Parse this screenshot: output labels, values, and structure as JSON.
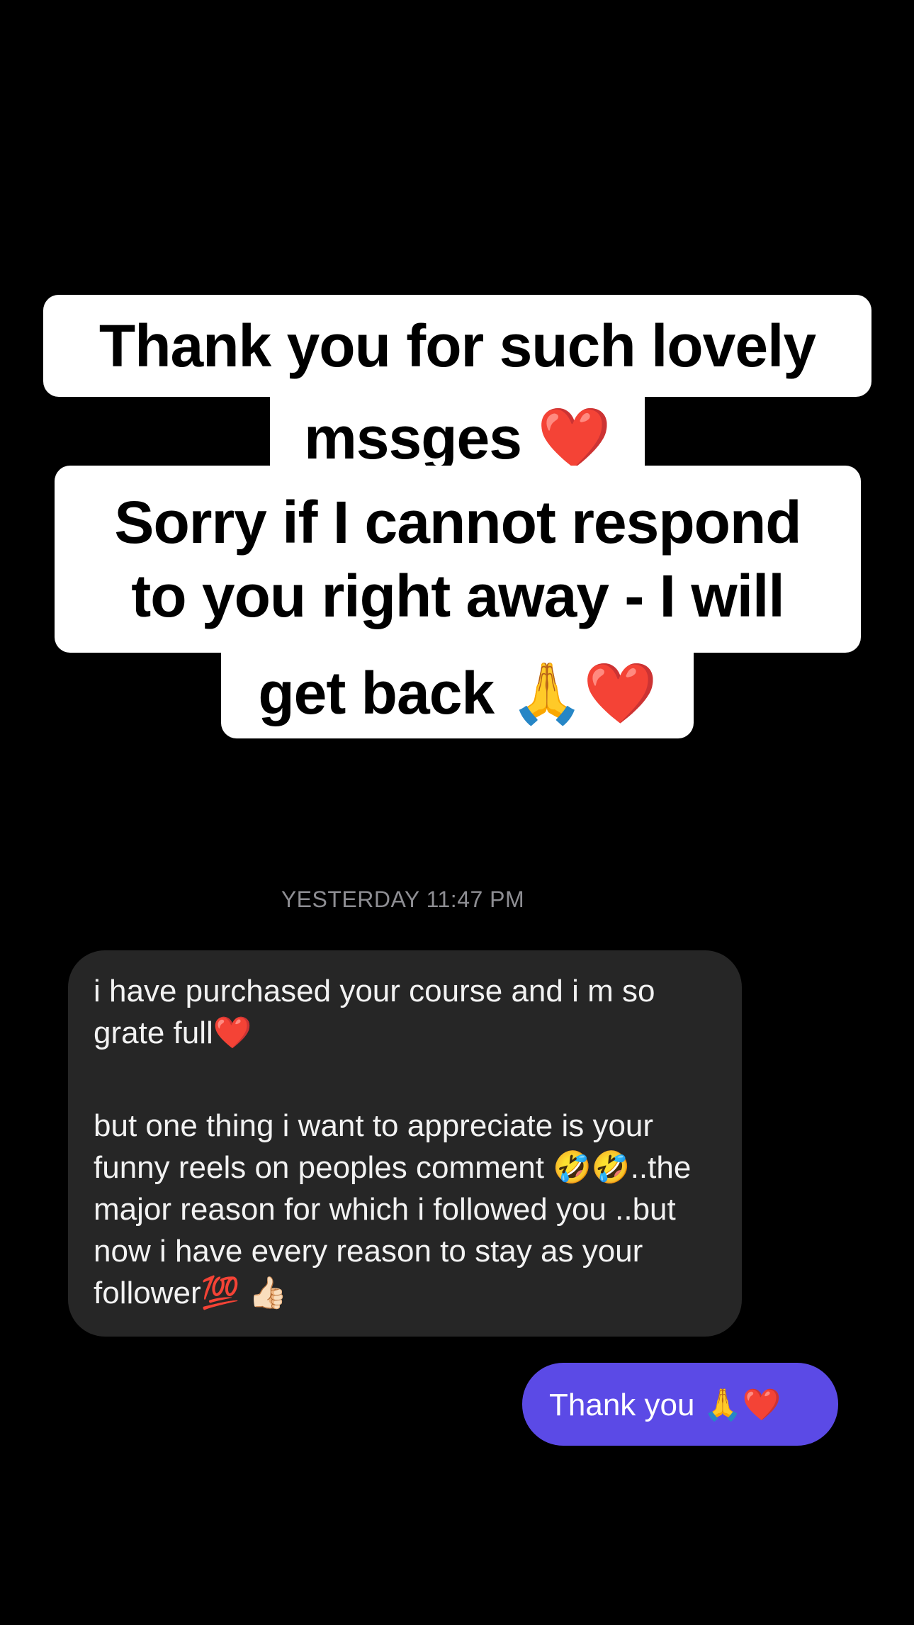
{
  "story_caption": {
    "line1": "Thank you for such lovely",
    "line2": "mssges ❤️",
    "line3a": "Sorry if I cannot respond",
    "line3b": "to you right away - I will",
    "line4": "get back 🙏❤️"
  },
  "conversation": {
    "timestamp": "YESTERDAY 11:47 PM",
    "incoming_message": {
      "paragraph1": "i have purchased your course and i m so grate full❤️",
      "paragraph2": "but one thing i want to appreciate is your funny reels on peoples comment 🤣🤣..the major reason for which i followed you ..but now i have every reason to stay as your follower💯 👍🏻"
    },
    "outgoing_message": {
      "text": "Thank you 🙏❤️"
    }
  },
  "colors": {
    "background": "#000000",
    "caption_bg": "#ffffff",
    "incoming_bubble": "#262626",
    "outgoing_bubble": "#5b4ae6",
    "timestamp": "#8e8e93"
  }
}
